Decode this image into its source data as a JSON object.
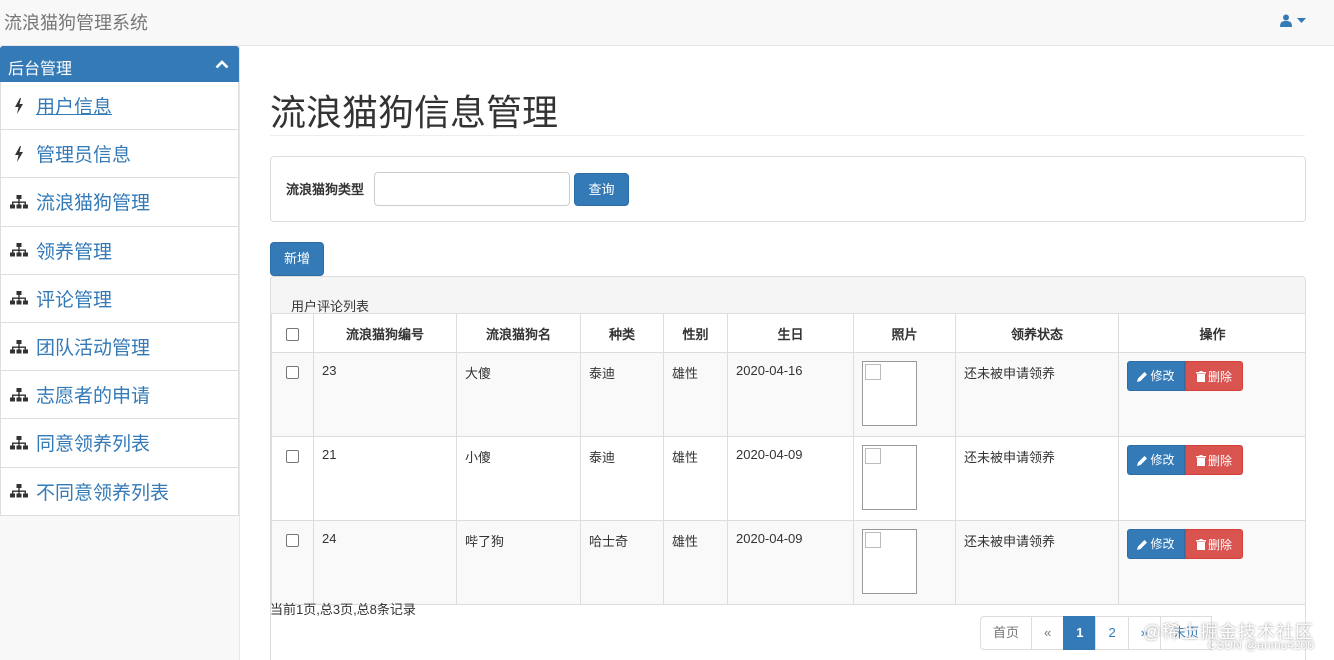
{
  "navbar": {
    "brand": "流浪猫狗管理系统"
  },
  "sidebar": {
    "header": "后台管理",
    "items": [
      {
        "label": "用户信息",
        "icon": "bolt-icon"
      },
      {
        "label": "管理员信息",
        "icon": "bolt-icon"
      },
      {
        "label": "流浪猫狗管理",
        "icon": "sitemap-icon"
      },
      {
        "label": "领养管理",
        "icon": "sitemap-icon"
      },
      {
        "label": "评论管理",
        "icon": "sitemap-icon"
      },
      {
        "label": "团队活动管理",
        "icon": "sitemap-icon"
      },
      {
        "label": "志愿者的申请",
        "icon": "sitemap-icon"
      },
      {
        "label": "同意领养列表",
        "icon": "sitemap-icon"
      },
      {
        "label": "不同意领养列表",
        "icon": "sitemap-icon"
      }
    ]
  },
  "main": {
    "title": "流浪猫狗信息管理",
    "search": {
      "label": "流浪猫狗类型",
      "value": "",
      "button": "查询"
    },
    "add_button": "新增",
    "table": {
      "caption": "用户评论列表",
      "headers": [
        "流浪猫狗编号",
        "流浪猫狗名",
        "种类",
        "性别",
        "生日",
        "照片",
        "领养状态",
        "操作"
      ],
      "rows": [
        {
          "id": "23",
          "name": "大傻",
          "breed": "泰迪",
          "gender": "雄性",
          "birthday": "2020-04-16",
          "status": "还未被申请领养"
        },
        {
          "id": "21",
          "name": "小傻",
          "breed": "泰迪",
          "gender": "雄性",
          "birthday": "2020-04-09",
          "status": "还未被申请领养"
        },
        {
          "id": "24",
          "name": "哔了狗",
          "breed": "哈士奇",
          "gender": "雄性",
          "birthday": "2020-04-09",
          "status": "还未被申请领养"
        }
      ],
      "edit_label": "修改",
      "delete_label": "删除"
    },
    "page_info": "当前1页,总3页,总8条记录",
    "pagination": {
      "first": "首页",
      "prev": "«",
      "pages": [
        "1",
        "2"
      ],
      "next": "»",
      "last": "末页",
      "current": "1"
    }
  },
  "watermark": {
    "line1": "@稀土掘金技术社区",
    "line2": "CSDN @anmu4200"
  },
  "colors": {
    "primary": "#337ab7",
    "danger": "#d9534f",
    "navbar_bg": "#f8f8f8"
  }
}
